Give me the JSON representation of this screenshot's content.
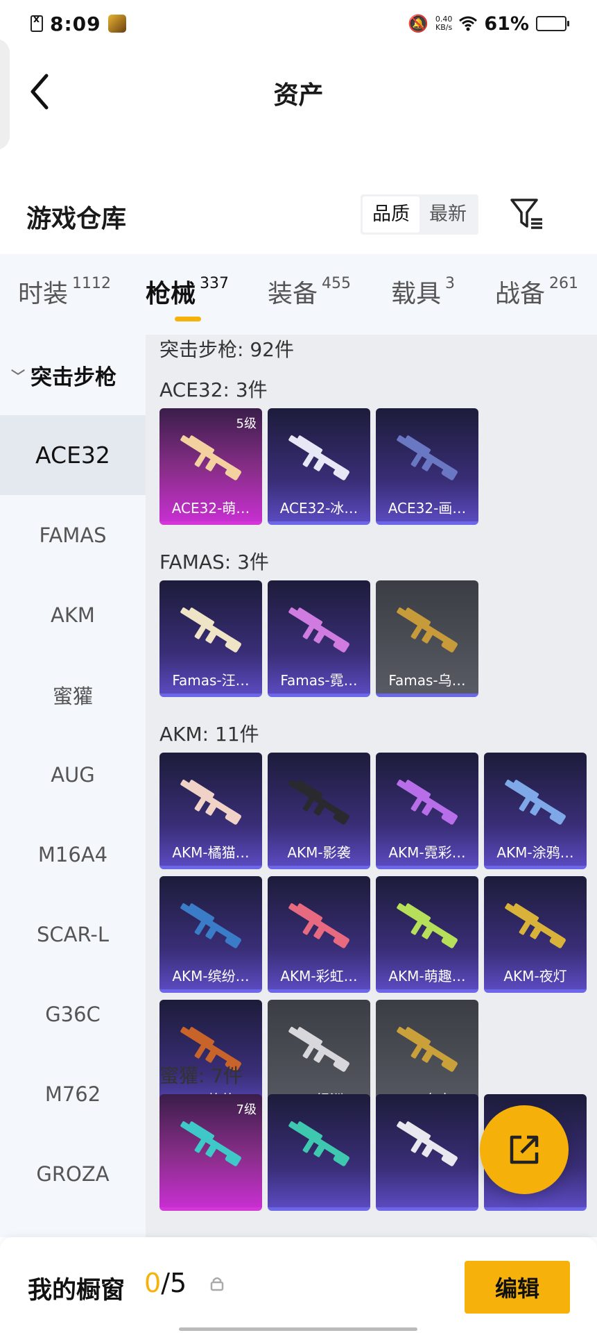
{
  "status_bar": {
    "time": "8:09",
    "net_speed_value": "0.40",
    "net_speed_unit": "KB/s",
    "battery": "61%",
    "battery_level": 0.61
  },
  "header": {
    "title": "资产"
  },
  "warehouse": {
    "title": "游戏仓库",
    "sort_options": [
      "品质",
      "最新"
    ],
    "sort_selected": "品质"
  },
  "tabs": [
    {
      "label": "时装",
      "count": "1112"
    },
    {
      "label": "枪械",
      "count": "337",
      "active": true
    },
    {
      "label": "装备",
      "count": "455"
    },
    {
      "label": "载具",
      "count": "3"
    },
    {
      "label": "战备",
      "count": "261"
    }
  ],
  "sidebar": {
    "group": "突击步枪",
    "items": [
      "ACE32",
      "FAMAS",
      "AKM",
      "蜜獾",
      "AUG",
      "M16A4",
      "SCAR-L",
      "G36C",
      "M762",
      "GROZA"
    ],
    "active": "ACE32"
  },
  "content": {
    "category_header": "突击步枪: 92件",
    "sections": [
      {
        "title": "ACE32: 3件",
        "cards": [
          {
            "name": "ACE32-萌…",
            "rarity": "gold",
            "level": "5级",
            "gun_color": "#f3d2a0"
          },
          {
            "name": "ACE32-冰…",
            "rarity": "purple",
            "gun_color": "#e6e8f5"
          },
          {
            "name": "ACE32-画…",
            "rarity": "purple",
            "gun_color": "#6a78c4"
          }
        ]
      },
      {
        "title": "FAMAS: 3件",
        "cards": [
          {
            "name": "Famas-汪…",
            "rarity": "purple",
            "gun_color": "#efe4c6"
          },
          {
            "name": "Famas-霓…",
            "rarity": "purple",
            "gun_color": "#d07be0"
          },
          {
            "name": "Famas-乌…",
            "rarity": "gray",
            "gun_color": "#c79a3a"
          }
        ]
      },
      {
        "title": "AKM: 11件",
        "cards": [
          {
            "name": "AKM-橘猫…",
            "rarity": "purple",
            "gun_color": "#f0d2c6"
          },
          {
            "name": "AKM-影袭",
            "rarity": "purple",
            "gun_color": "#2a2a2e"
          },
          {
            "name": "AKM-霓彩…",
            "rarity": "purple",
            "gun_color": "#b86ee8"
          },
          {
            "name": "AKM-涂鸦…",
            "rarity": "purple",
            "gun_color": "#7fa8e8"
          },
          {
            "name": "AKM-缤纷…",
            "rarity": "purple",
            "gun_color": "#3a7cc8"
          },
          {
            "name": "AKM-彩虹…",
            "rarity": "purple",
            "gun_color": "#e86a80"
          },
          {
            "name": "AKM-萌趣…",
            "rarity": "purple",
            "gun_color": "#b6e05a"
          },
          {
            "name": "AKM-夜灯",
            "rarity": "purple",
            "gun_color": "#d9b23a"
          },
          {
            "name": "AKM-灼热…",
            "rarity": "purple",
            "gun_color": "#c8642a"
          },
          {
            "name": "AKM-绿洲…",
            "rarity": "gray",
            "gun_color": "#d8d8dc"
          },
          {
            "name": "AKM-乌木…",
            "rarity": "gray",
            "gun_color": "#c9a03a"
          }
        ]
      },
      {
        "title": "蜜獾: 7件",
        "cards": [
          {
            "name": "",
            "rarity": "gold",
            "level": "7级",
            "gun_color": "#3ec8c8"
          },
          {
            "name": "",
            "rarity": "purple",
            "gun_color": "#3ec8b0"
          },
          {
            "name": "",
            "rarity": "purple",
            "gun_color": "#e8e8ee"
          },
          {
            "name": "",
            "rarity": "purple",
            "gun_color": "#e88a7a"
          }
        ]
      }
    ]
  },
  "bottom_bar": {
    "title": "我的橱窗",
    "count_current": "0",
    "count_sep_total": "/5",
    "edit_label": "编辑"
  }
}
